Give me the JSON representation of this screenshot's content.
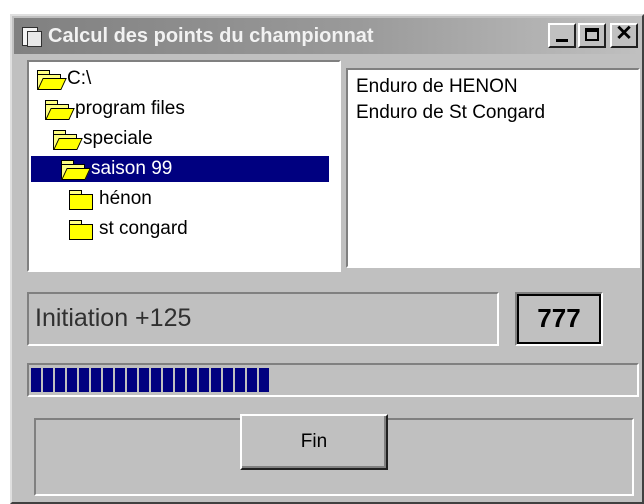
{
  "window": {
    "title": "Calcul des points du championnat",
    "icon": "app-document-icon",
    "controls": {
      "minimize": "minimize-icon",
      "maximize": "maximize-icon",
      "close": "✕"
    }
  },
  "tree": {
    "items": [
      {
        "label": "C:\\",
        "icon": "open-folder-icon",
        "selected": false
      },
      {
        "label": "program files",
        "icon": "open-folder-icon",
        "selected": false
      },
      {
        "label": "speciale",
        "icon": "open-folder-icon",
        "selected": false
      },
      {
        "label": "saison 99",
        "icon": "open-folder-icon",
        "selected": true
      },
      {
        "label": "hénon",
        "icon": "folder-icon",
        "selected": false
      },
      {
        "label": "st congard",
        "icon": "folder-icon",
        "selected": false
      }
    ]
  },
  "list": {
    "items": [
      "Enduro de HENON",
      "Enduro de St Congard"
    ]
  },
  "status": {
    "text": "Initiation +125"
  },
  "counter": {
    "value": "777"
  },
  "progress": {
    "fraction": 0.62,
    "color": "#000080"
  },
  "buttons": {
    "fin": "Fin"
  },
  "colors": {
    "face": "#c0c0c0",
    "selection": "#000080",
    "folder": "#ffff00"
  }
}
